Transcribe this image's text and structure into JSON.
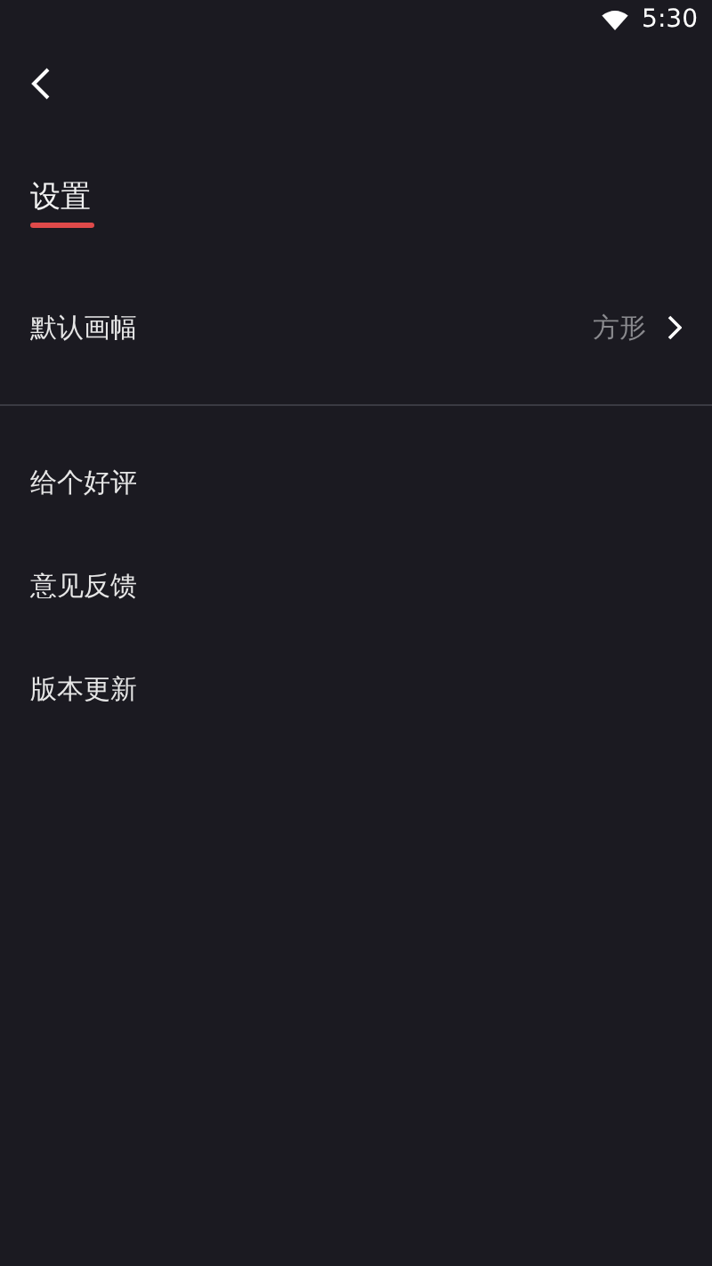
{
  "status_bar": {
    "time": "5:30"
  },
  "header": {
    "title": "设置"
  },
  "options": [
    {
      "label": "默认画幅",
      "value": "方形"
    }
  ],
  "links": [
    {
      "label": "给个好评"
    },
    {
      "label": "意见反馈"
    },
    {
      "label": "版本更新"
    }
  ]
}
